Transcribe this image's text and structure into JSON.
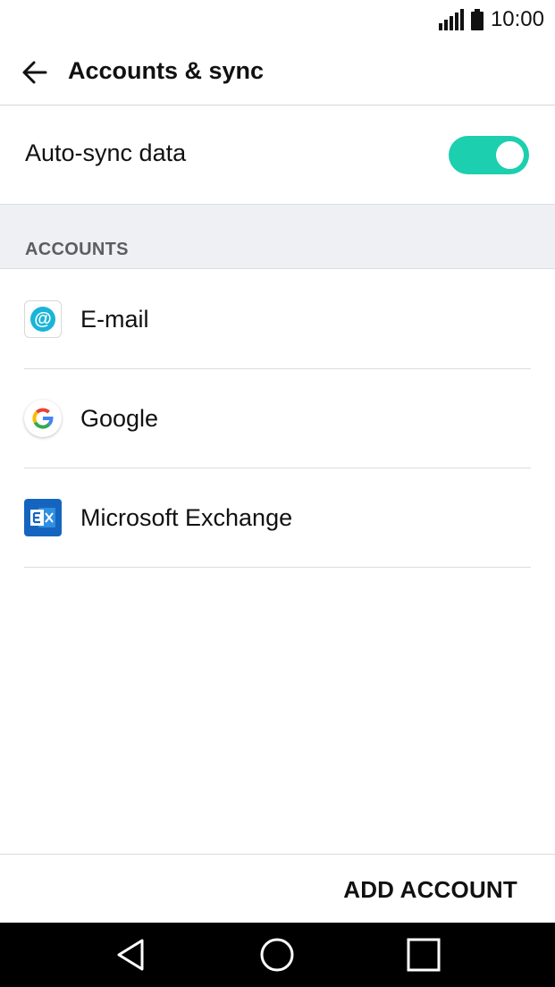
{
  "status_bar": {
    "time": "10:00"
  },
  "app_bar": {
    "title": "Accounts & sync",
    "back_icon": "arrow-back-icon"
  },
  "auto_sync": {
    "label": "Auto-sync data",
    "enabled": true,
    "accent_color": "#1ccfae"
  },
  "accounts_section": {
    "header": "ACCOUNTS",
    "items": [
      {
        "label": "E-mail",
        "icon": "email-at-icon"
      },
      {
        "label": "Google",
        "icon": "google-g-icon"
      },
      {
        "label": "Microsoft Exchange",
        "icon": "exchange-icon"
      }
    ]
  },
  "footer": {
    "add_account_label": "ADD ACCOUNT"
  },
  "nav_bar": {
    "back_icon": "triangle-back-icon",
    "home_icon": "circle-home-icon",
    "recents_icon": "square-recents-icon"
  }
}
